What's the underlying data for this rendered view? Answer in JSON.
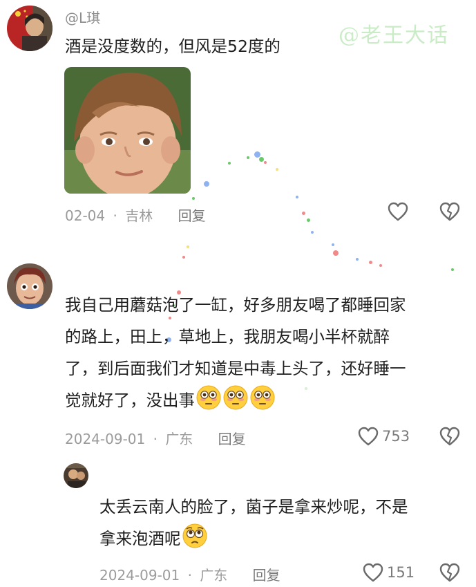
{
  "watermark": "@老王大话",
  "comments": [
    {
      "username": "@L琪",
      "text": "酒是没度数的，但风是52度的",
      "date": "02-04",
      "location": "吉林",
      "reply_label": "回复",
      "like_count": ""
    },
    {
      "username": "",
      "text_lines": [
        "我自己用蘑菇泡了一缸，好多朋友喝了都睡回家",
        "的路上，田上，草地上，我朋友喝小半杯就醉",
        "了，到后面我们才知道是中毒上头了，还好睡一",
        "觉就好了，没出事"
      ],
      "date": "2024-09-01",
      "location": "广东",
      "reply_label": "回复",
      "like_count": "753"
    },
    {
      "username": "",
      "text_lines": [
        "太丢云南人的脸了，菌子是拿来炒呢，不是",
        "拿来泡酒呢"
      ],
      "date": "2024-09-01",
      "location": "广东",
      "reply_label": "回复",
      "like_count": "151"
    }
  ],
  "meta_separator": "·",
  "icons": [
    "like-icon",
    "dislike-icon",
    "flushed-emoji",
    "pleading-emoji"
  ],
  "colors": {
    "text": "#1f1f1f",
    "meta": "#9b9b9b",
    "watermark": "#c9ecc6",
    "emoji": "#ffcf3e"
  }
}
